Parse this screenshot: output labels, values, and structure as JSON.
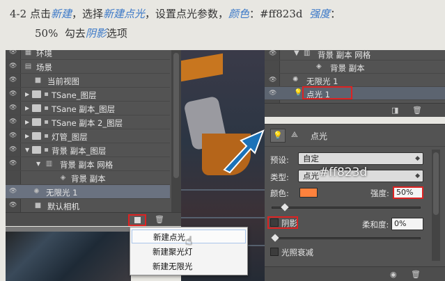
{
  "instruction": {
    "step": "4-2",
    "t1": "点击",
    "new": "新建",
    "t2": "，选择",
    "new_point": "新建点光",
    "t3": "，设置点光参数，",
    "color_word": "颜色",
    "t4": "：#ff823d",
    "strength_word": "强度",
    "t5": "：",
    "line2_pct": "50%",
    "line2_t1": "勾去",
    "shadow_word": "阴影",
    "line2_t2": "选项"
  },
  "layers": {
    "rows": [
      {
        "label": "环境"
      },
      {
        "label": "场景"
      },
      {
        "label": "当前视图"
      },
      {
        "label": "TSane_图层"
      },
      {
        "label": "TSane 副本_图层"
      },
      {
        "label": "TSane 副本 2_图层"
      },
      {
        "label": "灯管_图层"
      },
      {
        "label": "背景 副本_图层"
      },
      {
        "label": "背景 副本 网格"
      },
      {
        "label": "背景 副本"
      },
      {
        "label": "无限光 1"
      },
      {
        "label": "默认相机"
      }
    ]
  },
  "dropdown_menu": {
    "items": [
      "新建点光",
      "新建聚光灯",
      "新建无限光"
    ]
  },
  "scene_panel": {
    "rows": [
      "背景 副本 网格",
      "背景 副本",
      "无限光 1",
      "点光 1"
    ]
  },
  "properties": {
    "title": "点光",
    "preset_label": "预设:",
    "preset_value": "自定",
    "type_label": "类型:",
    "type_value": "点光",
    "color_label": "颜色:",
    "color_hex": "#ff823d",
    "strength_label": "强度:",
    "strength_value": "50%",
    "shadow_label": "阴影",
    "softness_label": "柔和度:",
    "softness_value": "0%",
    "falloff_label": "光照衰减",
    "overlay_text": "#ff823d"
  }
}
